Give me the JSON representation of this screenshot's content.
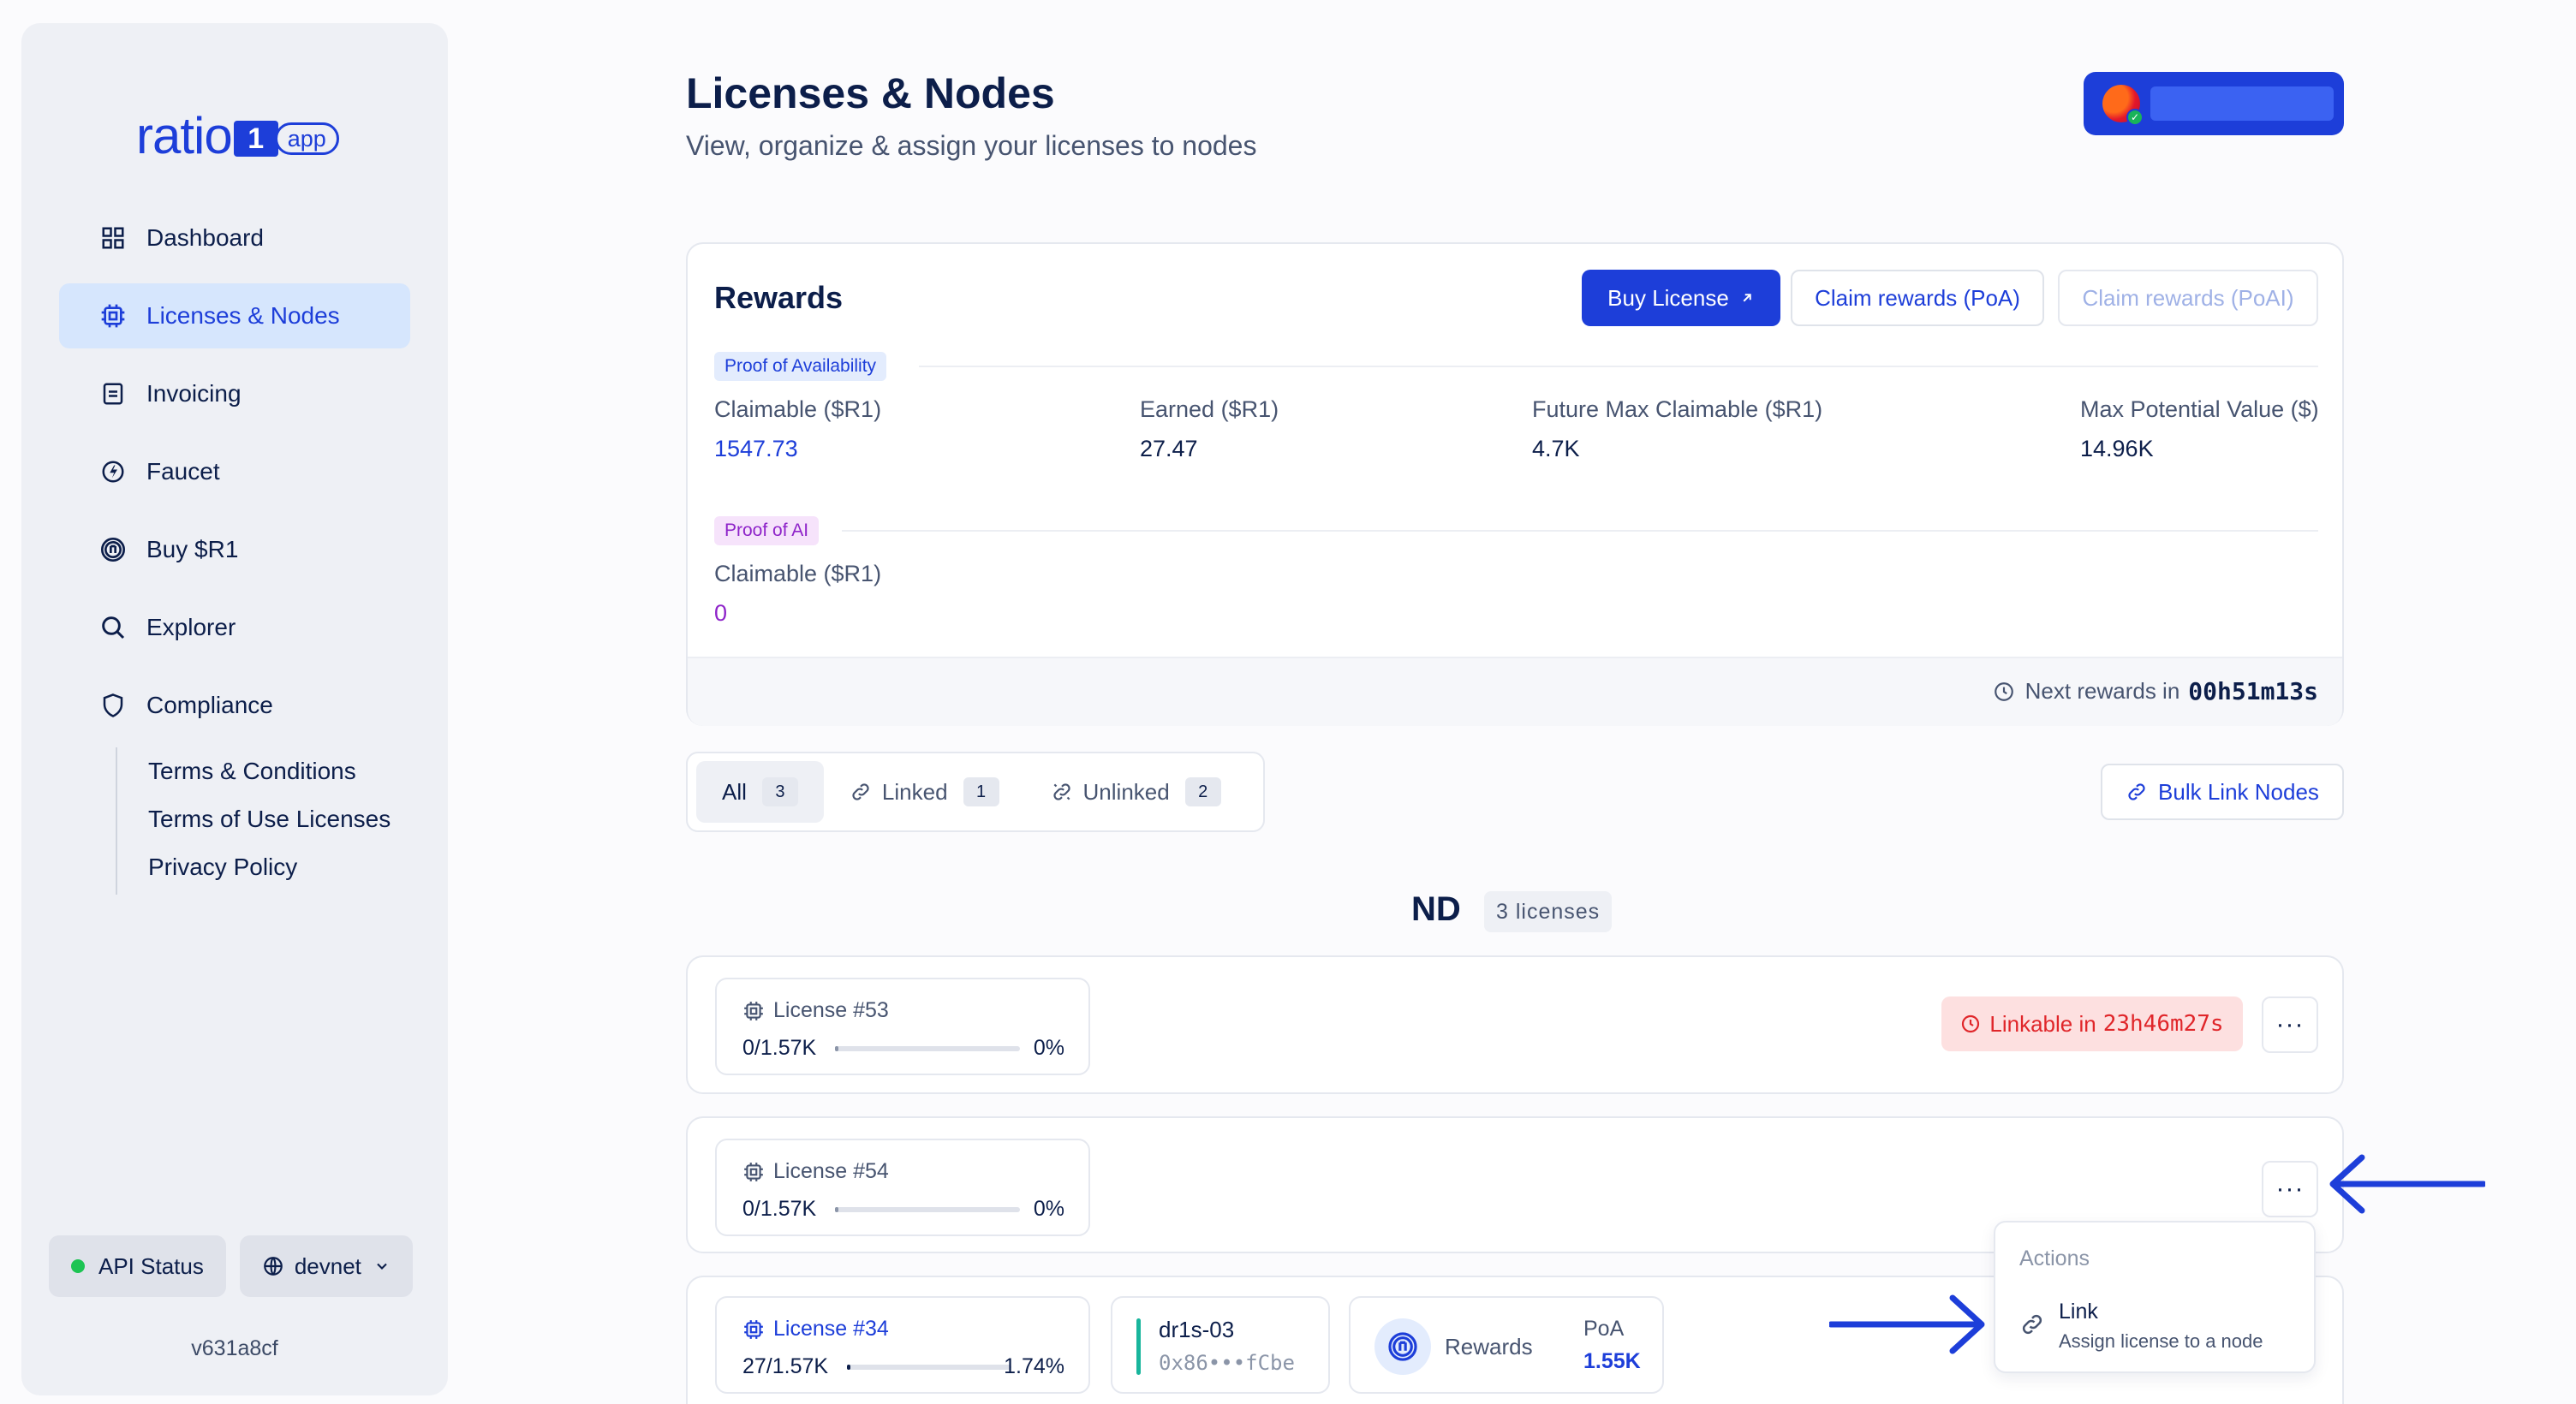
{
  "sidebar": {
    "logo": {
      "word": "ratio",
      "one": "1",
      "app": "app"
    },
    "items": [
      {
        "label": "Dashboard",
        "icon": "grid-icon"
      },
      {
        "label": "Licenses & Nodes",
        "icon": "chip-icon",
        "active": true
      },
      {
        "label": "Invoicing",
        "icon": "document-icon"
      },
      {
        "label": "Faucet",
        "icon": "faucet-icon"
      },
      {
        "label": "Buy $R1",
        "icon": "coin-icon"
      },
      {
        "label": "Explorer",
        "icon": "search-icon"
      },
      {
        "label": "Compliance",
        "icon": "shield-icon"
      }
    ],
    "compliance_links": [
      "Terms & Conditions",
      "Terms of Use Licenses",
      "Privacy Policy"
    ],
    "api_status": "API Status",
    "network": "devnet",
    "version": "v631a8cf"
  },
  "header": {
    "title": "Licenses & Nodes",
    "subtitle": "View, organize & assign your licenses to nodes"
  },
  "rewards": {
    "title": "Rewards",
    "buy_license": "Buy License",
    "claim_poa": "Claim rewards (PoA)",
    "claim_poai": "Claim rewards (PoAI)",
    "poa_tag": "Proof of Availability",
    "poa_stats": [
      {
        "label": "Claimable ($R1)",
        "value": "1547.73"
      },
      {
        "label": "Earned ($R1)",
        "value": "27.47"
      },
      {
        "label": "Future Max Claimable ($R1)",
        "value": "4.7K"
      },
      {
        "label": "Max Potential Value ($)",
        "value": "14.96K"
      }
    ],
    "poai_tag": "Proof of AI",
    "poai_stat": {
      "label": "Claimable ($R1)",
      "value": "0"
    },
    "next_rewards_label": "Next rewards in",
    "next_rewards_value": "00h51m13s"
  },
  "filters": {
    "tabs": [
      {
        "label": "All",
        "count": "3",
        "active": true
      },
      {
        "label": "Linked",
        "count": "1"
      },
      {
        "label": "Unlinked",
        "count": "2"
      }
    ],
    "bulk_link": "Bulk Link Nodes"
  },
  "nd": {
    "title": "ND",
    "count": "3 licenses",
    "licenses": [
      {
        "name": "License #53",
        "qty": "0/1.57K",
        "pct": "0%",
        "fill": 0,
        "linkable_label": "Linkable in",
        "linkable_time": "23h46m27s"
      },
      {
        "name": "License #54",
        "qty": "0/1.57K",
        "pct": "0%",
        "fill": 0
      },
      {
        "name": "License #34",
        "qty": "27/1.57K",
        "pct": "1.74%",
        "fill": 0.0174,
        "node_name": "dr1s-03",
        "node_addr": "0x86•••fCbe",
        "rewards_label": "Rewards",
        "poa_label": "PoA",
        "poa_value": "1.55K"
      }
    ]
  },
  "dropdown": {
    "header": "Actions",
    "item_title": "Link",
    "item_desc": "Assign license to a node"
  },
  "colors": {
    "accent": "#1d3ed9",
    "danger": "#e0262a",
    "poai": "#8e23c9",
    "ok": "#1dc453"
  }
}
